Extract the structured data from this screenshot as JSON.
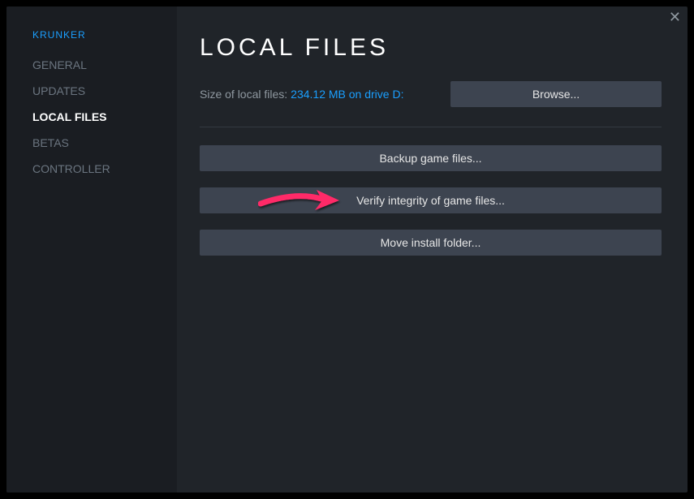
{
  "sidebar": {
    "game_title": "KRUNKER",
    "items": [
      {
        "label": "GENERAL",
        "active": false
      },
      {
        "label": "UPDATES",
        "active": false
      },
      {
        "label": "LOCAL FILES",
        "active": true
      },
      {
        "label": "BETAS",
        "active": false
      },
      {
        "label": "CONTROLLER",
        "active": false
      }
    ]
  },
  "main": {
    "title": "LOCAL FILES",
    "size_label": "Size of local files:",
    "size_value": "234.12 MB on drive D:",
    "browse_label": "Browse...",
    "backup_label": "Backup game files...",
    "verify_label": "Verify integrity of game files...",
    "move_label": "Move install folder..."
  },
  "annotation": {
    "arrow_color": "#ff2a68"
  }
}
